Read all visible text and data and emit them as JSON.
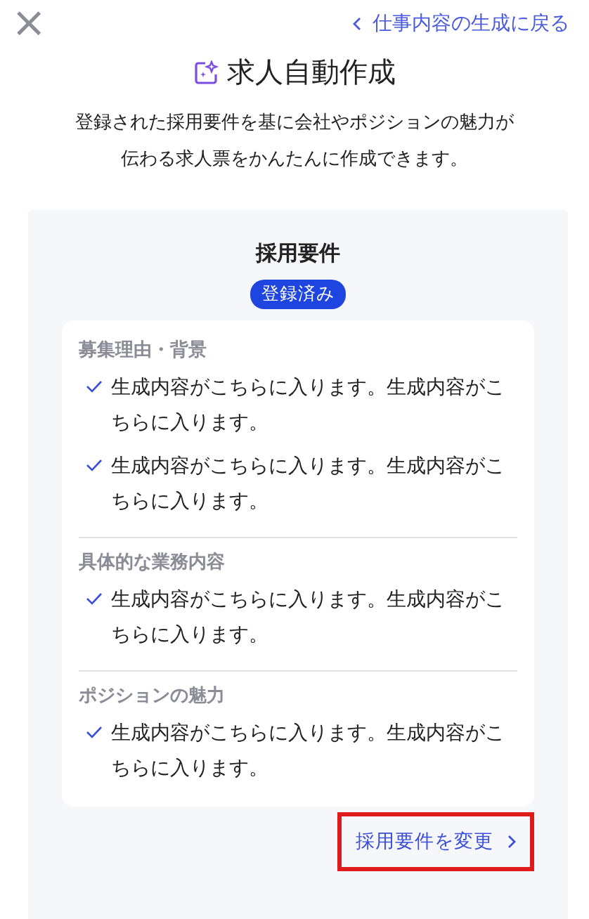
{
  "close_button": {
    "label": "×"
  },
  "back_link": {
    "label": "仕事内容の生成に戻る"
  },
  "title": "求人自動作成",
  "description": "登録された採用要件を基に会社やポジションの魅力が伝わる求人票をかんたんに作成できます。",
  "requirements": {
    "heading": "採用要件",
    "status": "登録済み",
    "sections": [
      {
        "title": "募集理由・背景",
        "items": [
          "生成内容がこちらに入ります。生成内容がこちらに入ります。",
          "生成内容がこちらに入ります。生成内容がこちらに入ります。"
        ]
      },
      {
        "title": "具体的な業務内容",
        "items": [
          "生成内容がこちらに入ります。生成内容がこちらに入ります。"
        ]
      },
      {
        "title": "ポジションの魅力",
        "items": [
          "生成内容がこちらに入ります。生成内容がこちらに入ります。"
        ]
      }
    ],
    "change_link": {
      "label": "採用要件を変更",
      "highlighted": true
    }
  }
}
